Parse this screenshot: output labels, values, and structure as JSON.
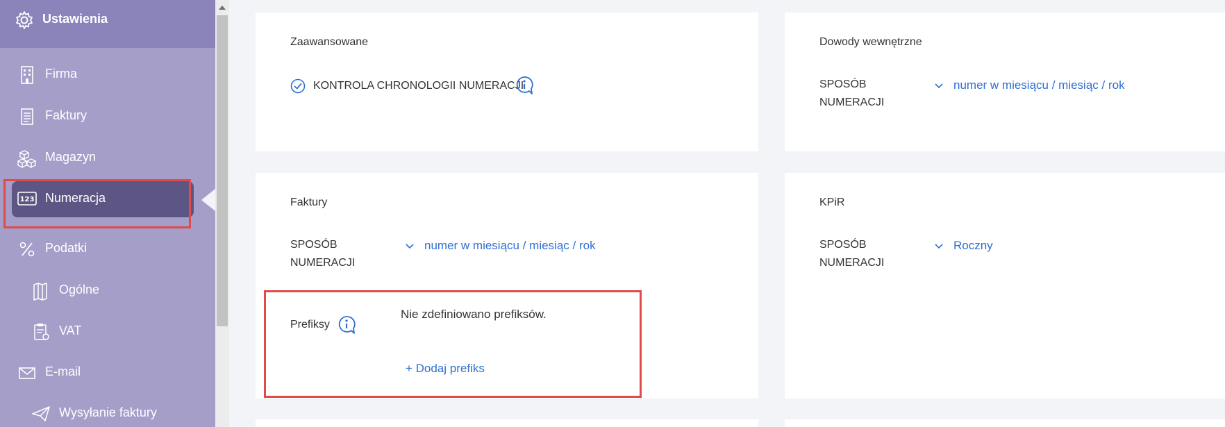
{
  "sidebar": {
    "header": {
      "label": "Ustawienia",
      "icon": "gear-icon"
    },
    "items": [
      {
        "label": "Firma",
        "icon": "building-icon"
      },
      {
        "label": "Faktury",
        "icon": "invoice-icon"
      },
      {
        "label": "Magazyn",
        "icon": "boxes-icon"
      },
      {
        "label": "Numeracja",
        "icon": "numbering-123-icon",
        "active": true
      },
      {
        "label": "Podatki",
        "icon": "percent-icon"
      },
      {
        "label": "Ogólne",
        "icon": "book-icon"
      },
      {
        "label": "VAT",
        "icon": "clipboard-icon"
      },
      {
        "label": "E-mail",
        "icon": "envelope-icon"
      },
      {
        "label": "Wysyłanie faktury",
        "icon": "paper-plane-icon"
      }
    ]
  },
  "cards": {
    "advanced": {
      "title": "Zaawansowane",
      "check_label": "KONTROLA CHRONOLOGII NUMERACJI"
    },
    "internal": {
      "title": "Dowody wewnętrzne",
      "field_label": "SPOSÓB NUMERACJI",
      "value": "numer w miesiącu / miesiąc / rok"
    },
    "invoices": {
      "title": "Faktury",
      "field_label": "SPOSÓB NUMERACJI",
      "value": "numer w miesiącu / miesiąc / rok",
      "prefixes_label": "Prefiksy",
      "no_prefixes": "Nie zdefiniowano prefiksów.",
      "add_prefix": "+ Dodaj prefiks"
    },
    "kpir": {
      "title": "KPiR",
      "field_label": "SPOSÓB NUMERACJI",
      "value": "Roczny"
    }
  },
  "colors": {
    "sidebar": "#a49ec9",
    "sidebar_header": "#8a84ba",
    "active_item": "#5d5684",
    "link": "#2f6fd1",
    "highlight_border": "#e24a4a"
  }
}
